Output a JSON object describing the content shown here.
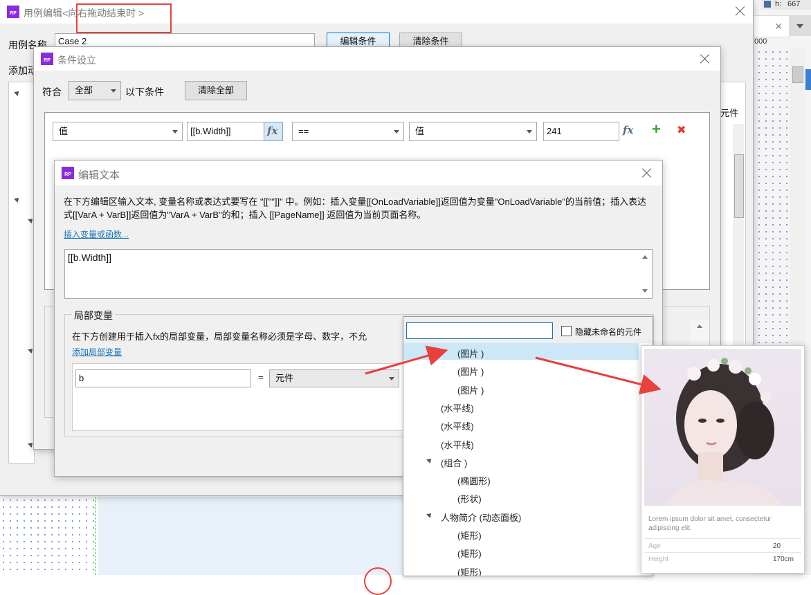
{
  "background": {
    "top_right_field": "667",
    "top_right_prefix": "h:",
    "ruler_value": "000"
  },
  "case_window": {
    "title": "用例编辑<向右拖动结束时 >",
    "case_name_label": "用例名称",
    "case_name_value": "Case 2",
    "edit_condition_btn": "编辑条件",
    "clear_condition_btn": "清除条件",
    "add_action_label": "添加动",
    "right_partial": "元件"
  },
  "condition_window": {
    "title": "条件设立",
    "match_label": "符合",
    "match_value": "全部",
    "condition_suffix": "以下条件",
    "clear_all_btn": "清除全部",
    "row": {
      "left_type": "值",
      "left_value": "[[b.Width]]",
      "fx": "fx",
      "operator": "==",
      "right_type": "值",
      "right_value": "241"
    },
    "add_icon": "+",
    "delete_icon": "✖"
  },
  "edit_text_window": {
    "title": "编辑文本",
    "description": "在下方编辑区输入文本, 变量名称或表达式要写在 \"[[\"\"]]\" 中。例如：插入变量[[OnLoadVariable]]返回值为变量\"OnLoadVariable\"的当前值；插入表达式[[VarA + VarB]]返回值为\"VarA + VarB\"的和；插入 [[PageName]] 返回值为当前页面名称。",
    "insert_link": "插入变量或函数...",
    "text_value": "[[b.Width]]",
    "local_var_group": "局部变量",
    "local_var_desc": "在下方创建用于插入fx的局部变量，局部变量名称必须是字母、数字，不允",
    "add_local_var": "添加局部变量",
    "var_name": "b",
    "equals": "=",
    "var_type": "元件"
  },
  "widget_picker": {
    "search_placeholder": "",
    "hide_unnamed_label": "隐藏未命名的元件",
    "items": [
      {
        "label": "(图片 )",
        "indent": 2,
        "selected": true,
        "expander": false
      },
      {
        "label": "(图片 )",
        "indent": 2,
        "selected": false,
        "expander": false
      },
      {
        "label": "(图片 )",
        "indent": 2,
        "selected": false,
        "expander": false
      },
      {
        "label": "(水平线)",
        "indent": 1,
        "selected": false,
        "expander": false
      },
      {
        "label": "(水平线)",
        "indent": 1,
        "selected": false,
        "expander": false
      },
      {
        "label": "(水平线)",
        "indent": 1,
        "selected": false,
        "expander": false
      },
      {
        "label": "(组合 )",
        "indent": 1,
        "selected": false,
        "expander": true
      },
      {
        "label": "(椭圆形)",
        "indent": 2,
        "selected": false,
        "expander": false
      },
      {
        "label": "(形状)",
        "indent": 2,
        "selected": false,
        "expander": false
      },
      {
        "label": "人物简介 (动态面板)",
        "indent": 1,
        "selected": false,
        "expander": true
      },
      {
        "label": "(矩形)",
        "indent": 2,
        "selected": false,
        "expander": false
      },
      {
        "label": "(矩形)",
        "indent": 2,
        "selected": false,
        "expander": false
      },
      {
        "label": "(矩形)",
        "indent": 2,
        "selected": false,
        "expander": false
      }
    ]
  },
  "profile_card": {
    "caption": "Lorem ipsum dolor sit amet, consectetur adipiscing elit.",
    "age_label": "Age",
    "age_value": "20",
    "height_label": "Height",
    "height_value": "170cm"
  },
  "annotation_color": "#e8403a"
}
